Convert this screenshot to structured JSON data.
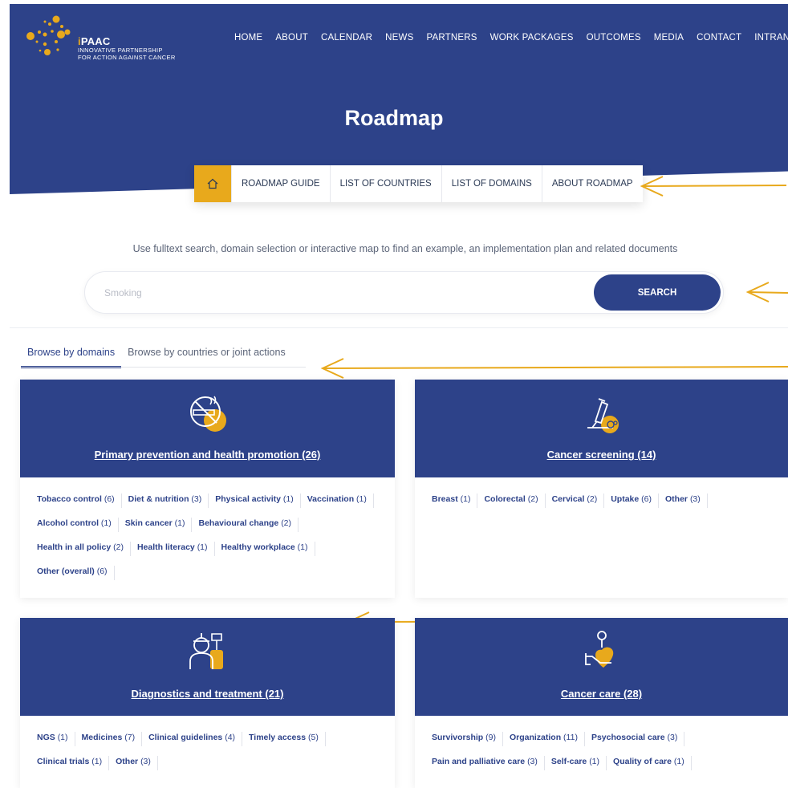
{
  "logo": {
    "name_i": "i",
    "name_rest": "PAAC",
    "subtitle": "INNOVATIVE PARTNERSHIP\nFOR ACTION AGAINST CANCER"
  },
  "topnav": [
    "HOME",
    "ABOUT",
    "CALENDAR",
    "NEWS",
    "PARTNERS",
    "WORK PACKAGES",
    "OUTCOMES",
    "MEDIA",
    "CONTACT",
    "INTRANET"
  ],
  "page_title": "Roadmap",
  "subnav": [
    "ROADMAP GUIDE",
    "LIST OF COUNTRIES",
    "LIST OF DOMAINS",
    "ABOUT ROADMAP"
  ],
  "intro": "Use fulltext search, domain selection or interactive map to find an example, an implementation plan and related documents",
  "search": {
    "placeholder": "Smoking",
    "button": "SEARCH"
  },
  "tabs": {
    "active": "Browse by domains",
    "other": "Browse by countries or joint actions"
  },
  "colors": {
    "brand_blue": "#2d4289",
    "accent_gold": "#e8a91c"
  },
  "cards": [
    {
      "title": "Primary prevention and health promotion (26)",
      "icon": "no-smoking-icon",
      "rows": [
        [
          [
            "Tobacco control",
            "(6)"
          ],
          [
            "Diet & nutrition",
            "(3)"
          ],
          [
            "Physical activity",
            "(1)"
          ],
          [
            "Vaccination",
            "(1)"
          ]
        ],
        [
          [
            "Alcohol control",
            "(1)"
          ],
          [
            "Skin cancer",
            "(1)"
          ],
          [
            "Behavioural change",
            "(2)"
          ]
        ],
        [
          [
            "Health in all policy",
            "(2)"
          ],
          [
            "Health literacy",
            "(1)"
          ],
          [
            "Healthy workplace",
            "(1)"
          ]
        ],
        [
          [
            "Other (overall)",
            "(6)"
          ]
        ]
      ]
    },
    {
      "title": "Cancer screening (14)",
      "icon": "microscope-icon",
      "rows": [
        [
          [
            "Breast",
            "(1)"
          ],
          [
            "Colorectal",
            "(2)"
          ],
          [
            "Cervical",
            "(2)"
          ],
          [
            "Uptake",
            "(6)"
          ],
          [
            "Other",
            "(3)"
          ]
        ]
      ]
    },
    {
      "title": "Diagnostics and treatment (21)",
      "icon": "doctor-icon",
      "rows": [
        [
          [
            "NGS",
            "(1)"
          ],
          [
            "Medicines",
            "(7)"
          ],
          [
            "Clinical guidelines",
            "(4)"
          ],
          [
            "Timely access",
            "(5)"
          ]
        ],
        [
          [
            "Clinical trials",
            "(1)"
          ],
          [
            "Other",
            "(3)"
          ]
        ]
      ]
    },
    {
      "title": "Cancer care (28)",
      "icon": "heart-hand-icon",
      "rows": [
        [
          [
            "Survivorship",
            "(9)"
          ],
          [
            "Organization",
            "(11)"
          ],
          [
            "Psychosocial care",
            "(3)"
          ]
        ],
        [
          [
            "Pain and palliative care",
            "(3)"
          ],
          [
            "Self-care",
            "(1)"
          ],
          [
            "Quality of care",
            "(1)"
          ]
        ]
      ]
    }
  ]
}
